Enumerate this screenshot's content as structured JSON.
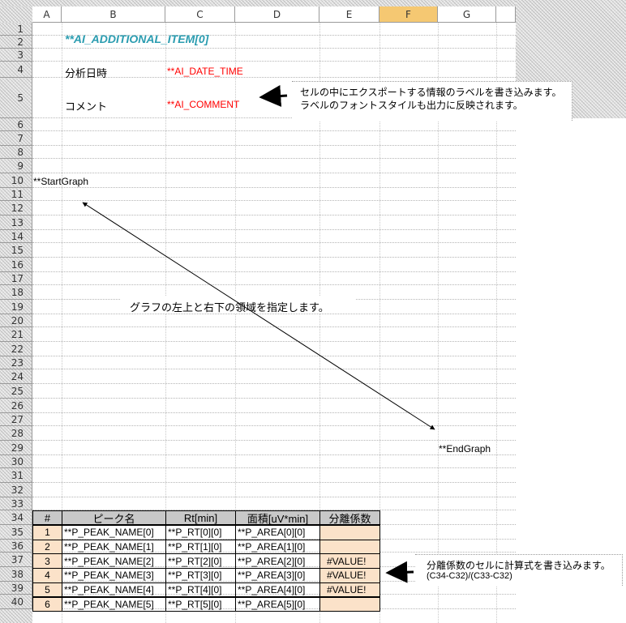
{
  "columns": [
    "A",
    "B",
    "C",
    "D",
    "E",
    "F",
    "G"
  ],
  "rows": [
    "1",
    "2",
    "3",
    "4",
    "5",
    "6",
    "7",
    "8",
    "9",
    "10",
    "11",
    "12",
    "13",
    "14",
    "15",
    "16",
    "17",
    "18",
    "19",
    "20",
    "21",
    "22",
    "23",
    "24",
    "25",
    "26",
    "27",
    "28",
    "29",
    "30",
    "31",
    "32",
    "33",
    "34",
    "35",
    "36",
    "37",
    "38",
    "39",
    "40"
  ],
  "cells": {
    "additional_item": "**AI_ADDITIONAL_ITEM[0]",
    "date_label": "分析日時",
    "date_value": "**AI_DATE_TIME",
    "comment_label": "コメント",
    "comment_value": "**AI_COMMENT",
    "start_graph": "**StartGraph",
    "end_graph": "**EndGraph"
  },
  "notes": {
    "label_note_line1": "セルの中にエクスポートする情報のラベルを書き込みます。",
    "label_note_line2": "ラベルのフォントスタイルも出力に反映されます。",
    "graph_note": "グラフの左上と右下の領域を指定します。",
    "formula_note_line1": "分離係数のセルに計算式を書き込みます。",
    "formula_note_line2": "(C34-C32)/(C33-C32)"
  },
  "table": {
    "headers": [
      "#",
      "ピーク名",
      "Rt[min]",
      "面積[uV*min]",
      "分離係数"
    ],
    "rows": [
      [
        "1",
        "**P_PEAK_NAME[0]",
        "**P_RT[0][0]",
        "**P_AREA[0][0]",
        ""
      ],
      [
        "2",
        "**P_PEAK_NAME[1]",
        "**P_RT[1][0]",
        "**P_AREA[1][0]",
        ""
      ],
      [
        "3",
        "**P_PEAK_NAME[2]",
        "**P_RT[2][0]",
        "**P_AREA[2][0]",
        "#VALUE!"
      ],
      [
        "4",
        "**P_PEAK_NAME[3]",
        "**P_RT[3][0]",
        "**P_AREA[3][0]",
        "#VALUE!"
      ],
      [
        "5",
        "**P_PEAK_NAME[4]",
        "**P_RT[4][0]",
        "**P_AREA[4][0]",
        "#VALUE!"
      ],
      [
        "6",
        "**P_PEAK_NAME[5]",
        "**P_RT[5][0]",
        "**P_AREA[5][0]",
        ""
      ]
    ]
  },
  "colors": {
    "selected_column_header": "#f5c872",
    "label_value_red": "#ff0000",
    "item_blue": "#2a9cb0",
    "table_header_gray": "#c8c8c8",
    "formula_cell_orange": "#fbe2c9"
  }
}
